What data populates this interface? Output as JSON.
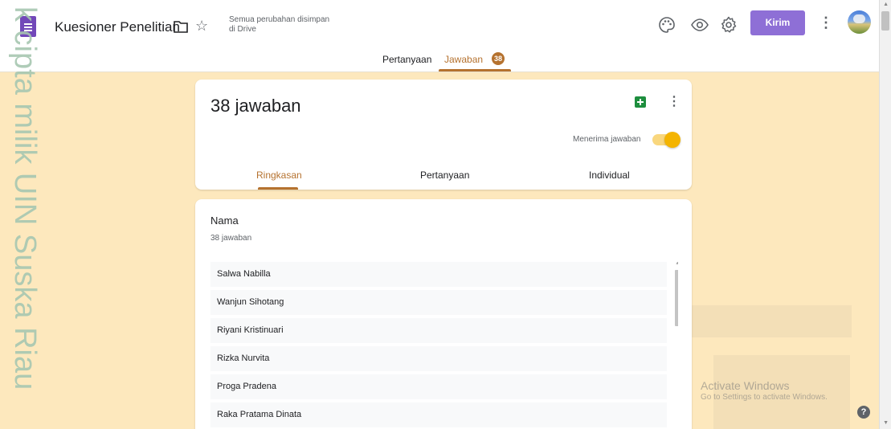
{
  "header": {
    "title": "Kuesioner Penelitian",
    "save_status": "Semua perubahan disimpan di Drive",
    "send_label": "Kirim",
    "icons": [
      "forms-app-icon",
      "folder-icon",
      "star-icon",
      "palette-icon",
      "eye-icon",
      "gear-icon",
      "more-vert-icon"
    ]
  },
  "tabs": [
    {
      "label": "Pertanyaan"
    },
    {
      "label": "Jawaban",
      "badge": "38",
      "active": true
    }
  ],
  "summary_card": {
    "responses_title": "38 jawaban",
    "accept_label": "Menerima jawaban",
    "accepting": true,
    "subtabs": [
      {
        "label": "Ringkasan",
        "active": true
      },
      {
        "label": "Pertanyaan"
      },
      {
        "label": "Individual"
      }
    ]
  },
  "question": {
    "title": "Nama",
    "count_label": "38 jawaban",
    "answers": [
      "Salwa Nabilla",
      "Wanjun Sihotang",
      "Riyani Kristinuari",
      "Rizka Nurvita",
      "Proga Pradena",
      "Raka Pratama Dinata"
    ]
  },
  "watermark": "k cipta milik UIN Suska Riau",
  "os_overlay": {
    "title": "Activate Windows",
    "subtitle": "Go to Settings to activate Windows."
  },
  "colors": {
    "accent": "#b5722f",
    "background": "#fde8bd",
    "send_button": "#8e6fd6",
    "toggle": "#f4b400"
  }
}
